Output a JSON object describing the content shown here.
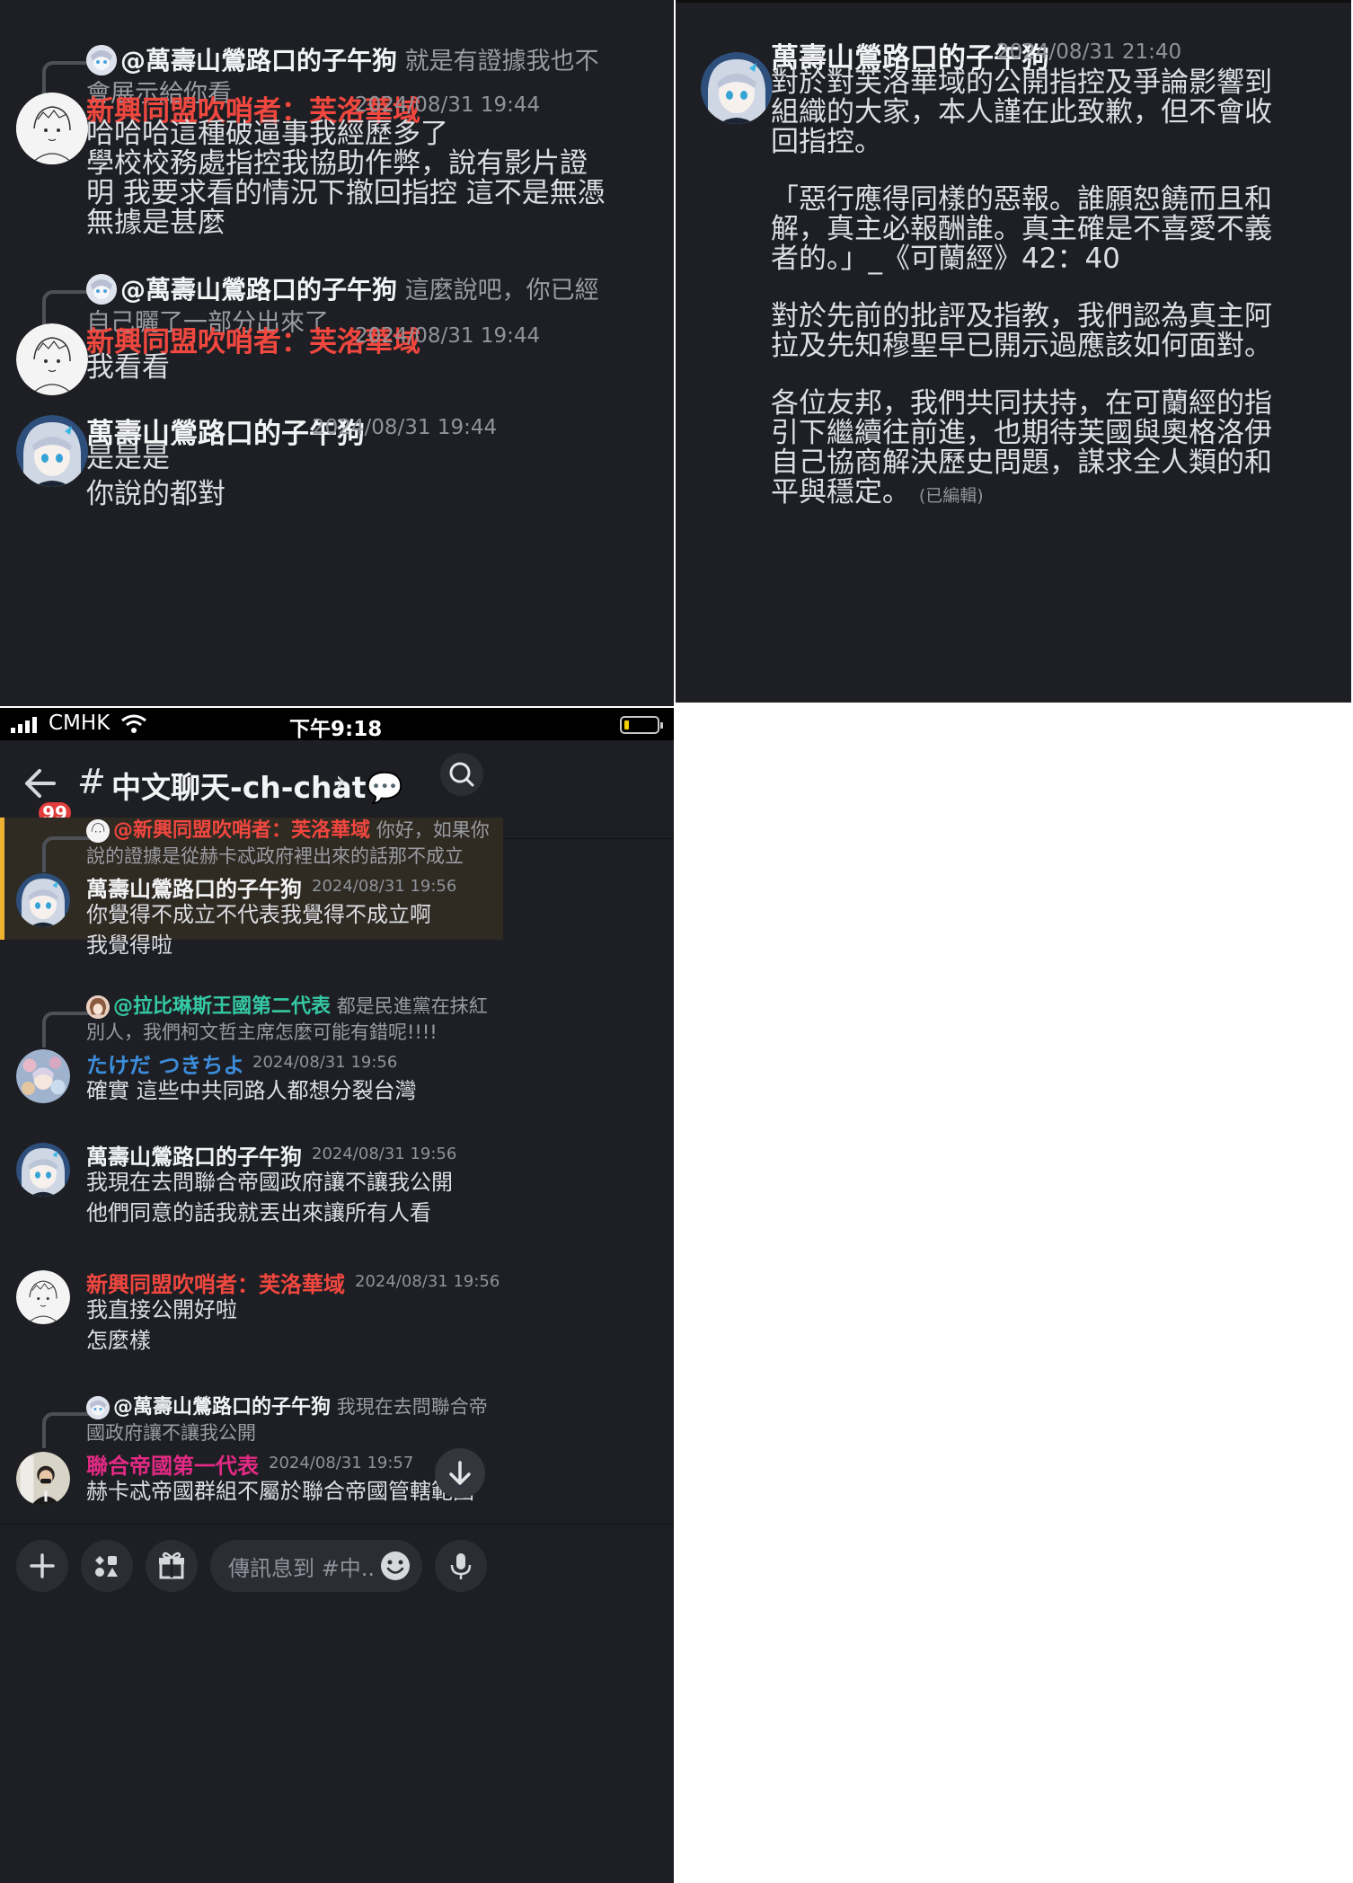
{
  "panel_a": {
    "messages": [
      {
        "reply": {
          "name": "@萬壽山鶯路口的子午狗",
          "text_line1": "就是有證據我也不",
          "text_line2": "會展示給你看"
        },
        "author": "新興同盟吹哨者：芙洛華域",
        "time": "2024/08/31 19:44",
        "lines": [
          "哈哈哈這種破逼事我經歷多了",
          "學校校務處指控我協助作弊，說有影片證",
          "明 我要求看的情況下撤回指控 這不是無憑",
          "無據是甚麼"
        ]
      },
      {
        "reply": {
          "name": "@萬壽山鶯路口的子午狗",
          "text_line1": "這麼說吧，你已經",
          "text_line2": "自己曬了一部分出來了"
        },
        "author": "新興同盟吹哨者：芙洛華域",
        "time": "2024/08/31 19:44",
        "lines": [
          "我看看"
        ]
      },
      {
        "author": "萬壽山鶯路口的子午狗",
        "time": "2024/08/31 19:44",
        "lines": [
          "是是是",
          "你說的都對"
        ]
      }
    ]
  },
  "panel_b": {
    "author": "萬壽山鶯路口的子午狗",
    "time": "2024/08/31 21:40",
    "paragraphs": [
      [
        "對於對芙洛華域的公開指控及爭論影響到",
        "組織的大家，本人謹在此致歉，但不會收",
        "回指控。"
      ],
      [
        "「惡行應得同樣的惡報。誰願恕饒而且和",
        "解，真主必報酬誰。真主確是不喜愛不義",
        "者的。」_《可蘭經》42：40"
      ],
      [
        "對於先前的批評及指教，我們認為真主阿",
        "拉及先知穆聖早已開示過應該如何面對。"
      ],
      [
        "各位友邦，我們共同扶持，在可蘭經的指",
        "引下繼續往前進，也期待芙國與奧格洛伊",
        "自己協商解決歷史問題，謀求全人類的和",
        "平與穩定。"
      ]
    ],
    "edited": "(已編輯)"
  },
  "status_bar": {
    "carrier": "CMHK",
    "time": "下午9:18"
  },
  "header": {
    "badge": "99",
    "hash": "#",
    "channel": "中文聊天-ch-chat💬",
    "chevron": "›"
  },
  "panel_c": {
    "messages": [
      {
        "reply": {
          "name": "@新興同盟吹哨者：芙洛華域",
          "text_line1": "你好，如果你",
          "text_line2": "說的證據是從赫卡忒政府裡出來的話那不成立"
        },
        "author": "萬壽山鶯路口的子午狗",
        "time": "2024/08/31 19:56",
        "lines": [
          "你覺得不成立不代表我覺得不成立啊",
          "我覺得啦"
        ]
      },
      {
        "reply": {
          "name": "@拉比琳斯王國第二代表",
          "text_line1": "都是民進黨在抹紅",
          "text_line2": "別人，我們柯文哲主席怎麼可能有錯呢!!!!"
        },
        "author": "たけだ つきちよ",
        "time": "2024/08/31 19:56",
        "lines": [
          "確實 這些中共同路人都想分裂台灣"
        ]
      },
      {
        "author": "萬壽山鶯路口的子午狗",
        "time": "2024/08/31 19:56",
        "lines": [
          "我現在去問聯合帝國政府讓不讓我公開",
          "他們同意的話我就丟出來讓所有人看"
        ]
      },
      {
        "author": "新興同盟吹哨者：芙洛華域",
        "time": "2024/08/31 19:56",
        "lines": [
          "我直接公開好啦",
          "怎麼樣"
        ]
      },
      {
        "reply": {
          "name": "@萬壽山鶯路口的子午狗",
          "text_line1": "我現在去問聯合帝",
          "text_line2": "國政府讓不讓我公開"
        },
        "author": "聯合帝國第一代表",
        "time": "2024/08/31 19:57",
        "lines": [
          "赫卡忒帝國群組不屬於聯合帝國管轄範圍"
        ]
      }
    ]
  },
  "composer": {
    "placeholder": "傳訊息到 #中.."
  },
  "colors": {
    "bg": "#1e1f24",
    "red_role": "#f0473f",
    "teal_role": "#34c9a4",
    "blue_role": "#3c8ddb",
    "magenta_role": "#e22a85",
    "highlight": "#2f2a22",
    "highlight_bar": "#f0b232"
  }
}
